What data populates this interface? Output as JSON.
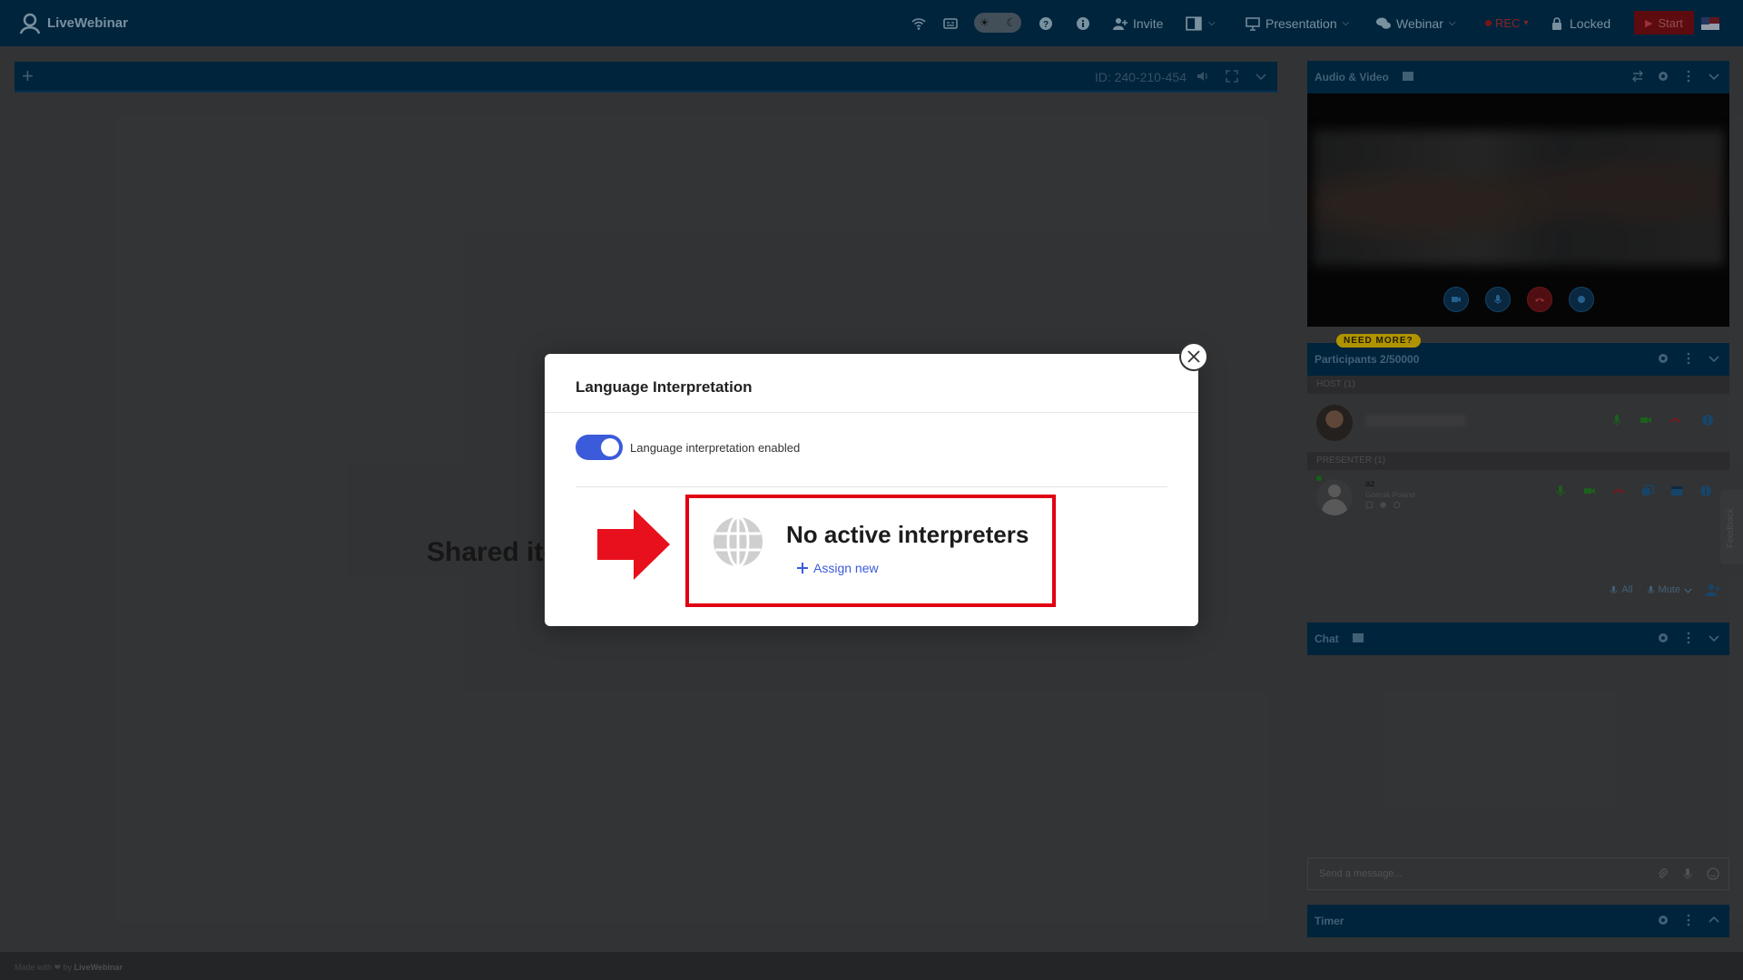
{
  "app": {
    "name": "LiveWebinar"
  },
  "topbar": {
    "invite_label": "Invite",
    "presentation_label": "Presentation",
    "webinar_label": "Webinar",
    "rec_label": "REC",
    "locked_label": "Locked",
    "start_label": "Start"
  },
  "stage": {
    "room_id": "ID: 240-210-454",
    "shared_title": "Shared items"
  },
  "audio_video": {
    "title": "Audio & Video"
  },
  "participants": {
    "badge": "NEED MORE?",
    "title": "Participants 2/50000",
    "host_label": "HOST (1)",
    "presenter_label": "PRESENTER (1)",
    "presenter_name": "az",
    "presenter_location": "Gdansk Poland",
    "mute_all_label": "All",
    "mute_label": "Mute"
  },
  "chat": {
    "title": "Chat",
    "placeholder": "Send a message..."
  },
  "timer": {
    "title": "Timer"
  },
  "feedback": {
    "label": "Feedback"
  },
  "footer": {
    "prefix": "Made with ❤ by",
    "brand": "LiveWebinar"
  },
  "modal": {
    "title": "Language Interpretation",
    "toggle_label": "Language interpretation enabled",
    "toggle_on": true,
    "empty_title": "No active interpreters",
    "assign_label": "Assign new"
  },
  "colors": {
    "accent_blue": "#3b5bdb",
    "highlight_red": "#e00012",
    "topbar_bg": "#002a45"
  }
}
